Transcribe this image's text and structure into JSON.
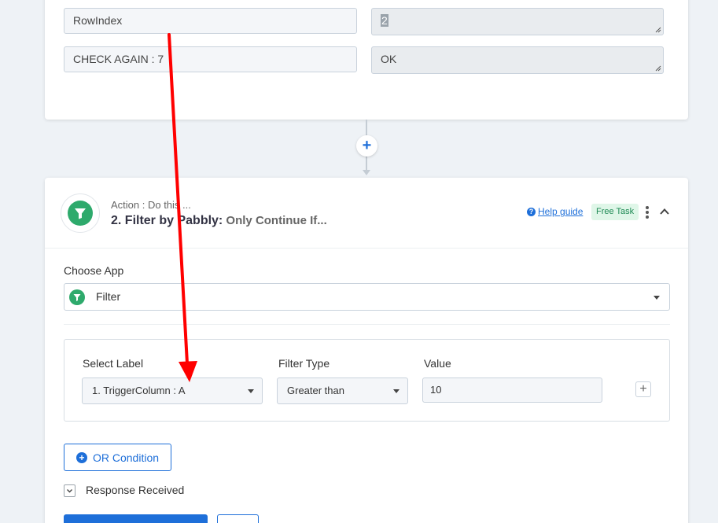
{
  "mapping_rows": [
    {
      "label": "RowIndex",
      "value": "2"
    },
    {
      "label": "CHECK AGAIN : 7",
      "value": "OK"
    }
  ],
  "connector": {
    "add_symbol": "+"
  },
  "action": {
    "prefix": "Action : Do this ...",
    "title": "2. Filter by Pabbly:",
    "subtitle": " Only Continue If...",
    "help_label": "Help guide",
    "help_symbol": "?",
    "badge": "Free Task"
  },
  "choose_app": {
    "label": "Choose App",
    "value": "Filter"
  },
  "filter": {
    "select_label_heading": "Select Label",
    "select_label_value": "1. TriggerColumn : A",
    "filter_type_heading": "Filter Type",
    "filter_type_value": "Greater than",
    "value_heading": "Value",
    "value_input": "10",
    "add_symbol": "+"
  },
  "or_condition": {
    "label": "OR Condition",
    "symbol": "+"
  },
  "response": {
    "label": "Response Received"
  },
  "colors": {
    "primary": "#1e6fd9",
    "app_green": "#2eaa6c",
    "annotation_red": "#ff0000"
  },
  "icons": [
    "filter-icon",
    "help-icon",
    "kebab-icon",
    "chevron-up-icon",
    "caret-down-icon",
    "plus-icon",
    "chevron-down-icon",
    "resize-grip-icon"
  ]
}
